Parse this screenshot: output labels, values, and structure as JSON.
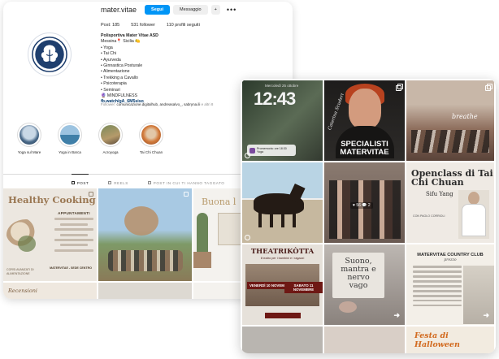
{
  "profile": {
    "username": "mater.vitae",
    "follow_label": "Segui",
    "message_label": "Messaggio",
    "add_label": "+",
    "more_label": "•••",
    "stats": {
      "posts": "Post: 185",
      "followers": "531 follower",
      "following": "110 profili seguiti"
    },
    "bio": {
      "name": "Polisportiva Mater Vitae ASD",
      "location": "Messina📍 Sicilia 🍋",
      "items": [
        "• Yoga",
        "• Tai Chi",
        "• Ayurveda",
        "• Ginnastica Posturale",
        "• Alimentazione",
        "• Trekking a Cavallo",
        "• Psicoterapia",
        "• Seminari"
      ],
      "mindfulness": "🔮 MINDFULNESS",
      "link": "fb.watch/gA_6M5siso"
    },
    "followers_line": {
      "prefix": "Follower: ",
      "names": "comunicazione.digitalhub, andreasalvo_, sabryna.ili",
      "suffix": " e altri 8"
    },
    "highlights": [
      {
        "label": "Yoga sul Mare"
      },
      {
        "label": "Yoga in Barca"
      },
      {
        "label": "Acroyoga"
      },
      {
        "label": "Tai Chi Chuan"
      }
    ],
    "tabs": [
      {
        "label": "POST",
        "active": true
      },
      {
        "label": "REELS",
        "active": false
      },
      {
        "label": "POST IN CUI TI HANNO TAGGATO",
        "active": false
      }
    ]
  },
  "profile_posts": {
    "healthy": {
      "title_a": "Healthy",
      "title_b": "Cooking",
      "appointments": "APPUNTAMENTI",
      "small": "CORSI AVANZATI DI ALIMENTAZIONE",
      "location": "MATERVITAE - SEDE CENTRO"
    },
    "buona": {
      "title": "Buona l"
    },
    "recensioni": {
      "caption": "Recensioni"
    }
  },
  "grid_posts": {
    "clock": {
      "time": "12:43",
      "date": "Mercoledì 25 ottobre",
      "notif": "Promemoria: ore 18:30 Yoga"
    },
    "specialisti": {
      "title": "SPECIALISTI MATERVITAE",
      "signature": "Caterina Scuderi"
    },
    "breathe": {
      "script": "breathe"
    },
    "bambini": {
      "counter": "♥ 56 💬 2"
    },
    "taichi": {
      "title": "Openclass di Tai Chi Chuan",
      "subtitle": "Sifu Yang",
      "meta": "CON PAOLO CORRIOLI"
    },
    "theatrikotta": {
      "title": "THEATRIKÒTTA",
      "subtitle": "il teatro per i bambini e i ragazzi",
      "day1": "VENERDÌ 10 NOVEMBRE",
      "day2": "SABATO 11 NOVEMBRE"
    },
    "suono": {
      "title": "Suono, mantra e nervo vago"
    },
    "country": {
      "title": "MATERVITAE COUNTRY CLUB",
      "subtitle": "prezzo"
    },
    "halloween": {
      "title": "Festa di Halloween"
    }
  }
}
